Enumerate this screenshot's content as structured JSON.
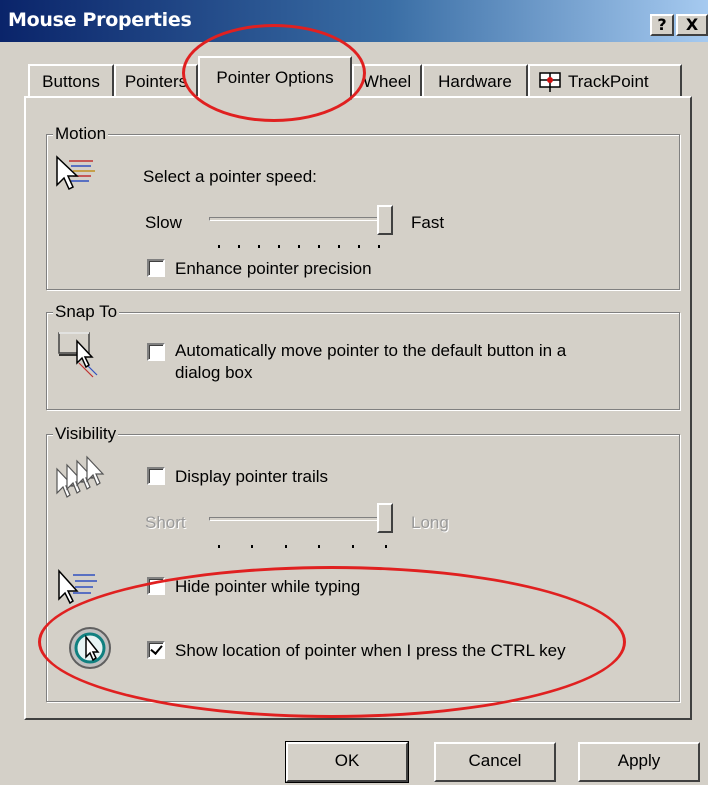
{
  "window": {
    "title": "Mouse Properties",
    "help_label": "?",
    "close_label": "X"
  },
  "tabs": [
    {
      "label": "Buttons"
    },
    {
      "label": "Pointers"
    },
    {
      "label": "Pointer Options",
      "selected": true
    },
    {
      "label": "Wheel"
    },
    {
      "label": "Hardware"
    },
    {
      "label": "TrackPoint"
    }
  ],
  "motion": {
    "group_label": "Motion",
    "speed_label": "Select a pointer speed:",
    "slow_label": "Slow",
    "fast_label": "Fast",
    "speed_level": 1.0,
    "enhance_label": "Enhance pointer precision",
    "enhance_checked": false
  },
  "snap": {
    "group_label": "Snap To",
    "auto_label_line1": "Automatically move pointer to the default button in a",
    "auto_label_line2": "dialog box",
    "auto_checked": false
  },
  "visibility": {
    "group_label": "Visibility",
    "trails_label": "Display pointer trails",
    "trails_checked": false,
    "short_label": "Short",
    "long_label": "Long",
    "trail_level": 1.0,
    "hide_label": "Hide pointer while typing",
    "hide_checked": false,
    "ctrl_label": "Show location of pointer when I press the CTRL key",
    "ctrl_checked": true
  },
  "buttons": {
    "ok": "OK",
    "cancel": "Cancel",
    "apply": "Apply"
  },
  "colors": {
    "dialog_bg": "#d4d0c8",
    "title_start": "#0a246a",
    "title_end": "#a6caf0",
    "highlight_ring": "#e02020"
  }
}
